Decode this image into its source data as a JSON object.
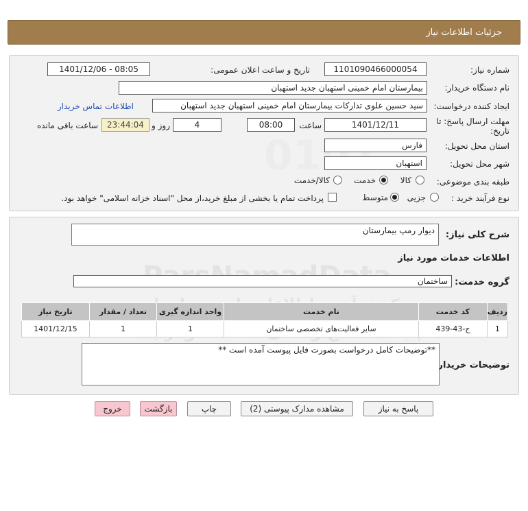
{
  "header": {
    "title": "جزئیات اطلاعات نیاز"
  },
  "form": {
    "need_number": {
      "label": "شماره نیاز:",
      "value": "1101090466000054"
    },
    "announce": {
      "label": "تاریخ و ساعت اعلان عمومی:",
      "value": "1401/12/06 - 08:05"
    },
    "buyer_org": {
      "label": "نام دستگاه خریدار:",
      "value": "بیمارستان امام خمینی استهبان جدید استهبان"
    },
    "requester": {
      "label": "ایجاد کننده درخواست:",
      "value": "سید حسین علوی تدارکات بیمارستان امام خمینی استهبان جدید استهبان",
      "contact_link": "اطلاعات تماس خریدار"
    },
    "deadline": {
      "label_line1": "مهلت ارسال پاسخ: تا",
      "label_line2": "تاریخ:",
      "date": "1401/12/11",
      "time_label": "ساعت",
      "time": "08:00",
      "days": "4",
      "days_label": "روز و",
      "remaining": "23:44:04",
      "remaining_label": "ساعت باقی مانده"
    },
    "province": {
      "label": "استان محل تحویل:",
      "value": "فارس"
    },
    "city": {
      "label": "شهر محل تحویل:",
      "value": "استهبان"
    },
    "category": {
      "label": "طبقه بندی موضوعی:",
      "options": [
        "کالا",
        "خدمت",
        "کالا/خدمت"
      ],
      "selected": "خدمت"
    },
    "process": {
      "label": "نوع فرآیند خرید :",
      "options": [
        "جزیی",
        "متوسط"
      ],
      "selected": "متوسط",
      "note": "پرداخت تمام یا بخشی از مبلغ خرید،از محل \"اسناد خزانه اسلامی\" خواهد بود."
    }
  },
  "details": {
    "summary_label": "شرح کلی نیاز:",
    "summary": "دیوار رمپ بیمارستان",
    "services_title": "اطلاعات خدمات مورد نیاز",
    "group_label": "گروه خدمت:",
    "group": "ساختمان",
    "table": {
      "headers": [
        "ردیف",
        "کد خدمت",
        "نام خدمت",
        "واحد اندازه گیری",
        "تعداد / مقدار",
        "تاریخ نیاز"
      ],
      "rows": [
        [
          "1",
          "ج-43-439",
          "سایر فعالیت‌های تخصصی ساختمان",
          "1",
          "1",
          "1401/12/15"
        ]
      ]
    },
    "buyer_notes_label": "توضیحات خریدار:",
    "buyer_notes": "**توضیحات کامل درخواست بصورت فایل پیوست آمده است **"
  },
  "buttons": {
    "reply": "پاسخ به نیاز",
    "attachments": "مشاهده مدارک پیوستی (2)",
    "print": "چاپ",
    "back": "بازگشت",
    "exit": "خروج"
  },
  "watermark": {
    "brand": "ParsNamadData",
    "tagline": "مرکز فرآوری اطلاعات پارس نماد داده",
    "subtitle": "پایگاه اطلاع رسانی مناقصه ومزایده",
    "phone": "۰۲۱-۸۸۳۴۹۶۷۰-۵",
    "digits": "0101"
  },
  "colors": {
    "header_bg": "#a17d4d",
    "link": "#1f4fb8",
    "danger_btn": "#f8c6cf"
  }
}
